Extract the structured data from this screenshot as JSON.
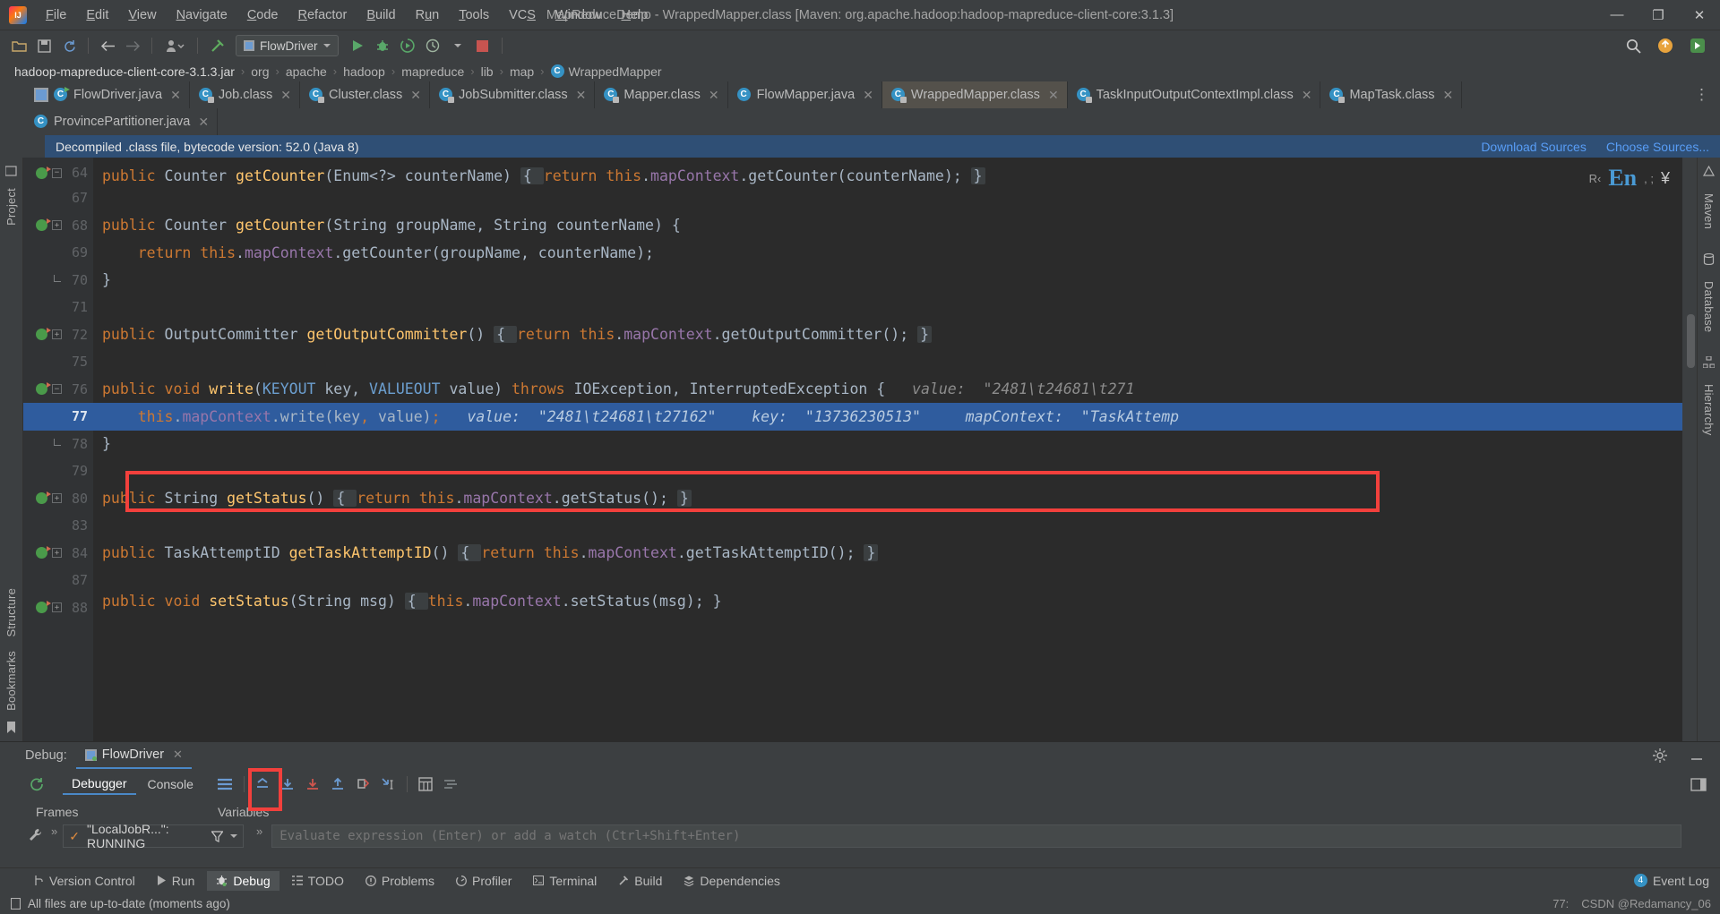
{
  "window": {
    "title": "MapReduceDemo - WrappedMapper.class [Maven: org.apache.hadoop:hadoop-mapreduce-client-core:3.1.3]",
    "minimize": "—",
    "maximize": "❐",
    "close": "✕"
  },
  "menu": [
    "File",
    "Edit",
    "View",
    "Navigate",
    "Code",
    "Refactor",
    "Build",
    "Run",
    "Tools",
    "VCS",
    "Window",
    "Help"
  ],
  "toolbar": {
    "run_config": "FlowDriver",
    "open_icon": "open-folder-icon",
    "save_icon": "save-icon",
    "sync_icon": "sync-icon",
    "back_icon": "back-arrow-icon",
    "forward_icon": "forward-arrow-icon",
    "profile_icon": "user-profile-icon",
    "build_icon": "hammer-icon",
    "run_icon": "run-icon",
    "debug_icon": "debug-icon",
    "coverage_icon": "run-with-coverage-icon",
    "profiler_icon": "profiler-icon",
    "stop_icon": "stop-icon",
    "search_icon": "search-icon",
    "update_icon": "update-badge-icon",
    "ide_icon": "ide-settings-icon"
  },
  "breadcrumb": {
    "root": "hadoop-mapreduce-client-core-3.1.3.jar",
    "path": [
      "org",
      "apache",
      "hadoop",
      "mapreduce",
      "lib",
      "map"
    ],
    "leaf": "WrappedMapper",
    "separator": "›"
  },
  "tabs_row1": [
    {
      "label": "FlowDriver.java",
      "icon": "java-class-runnable-icon",
      "active": false,
      "selected": false
    },
    {
      "label": "Job.class",
      "icon": "java-class-locked-icon",
      "active": false,
      "selected": false
    },
    {
      "label": "Cluster.class",
      "icon": "java-class-locked-icon",
      "active": false,
      "selected": false
    },
    {
      "label": "JobSubmitter.class",
      "icon": "java-class-locked-icon",
      "active": false,
      "selected": false
    },
    {
      "label": "Mapper.class",
      "icon": "java-class-locked-icon",
      "active": false,
      "selected": false
    },
    {
      "label": "FlowMapper.java",
      "icon": "java-class-icon",
      "active": false,
      "selected": false
    },
    {
      "label": "WrappedMapper.class",
      "icon": "java-class-locked-icon",
      "active": true,
      "selected": true
    },
    {
      "label": "TaskInputOutputContextImpl.class",
      "icon": "java-class-locked-icon",
      "active": false,
      "selected": false
    },
    {
      "label": "MapTask.class",
      "icon": "java-class-locked-icon",
      "active": false,
      "selected": false
    }
  ],
  "tabs_row2": [
    {
      "label": "ProvincePartitioner.java",
      "icon": "java-class-icon",
      "active": false,
      "selected": false
    }
  ],
  "notice": {
    "text": "Decompiled .class file, bytecode version: 52.0 (Java 8)",
    "download_sources": "Download Sources",
    "choose_sources": "Choose Sources..."
  },
  "editor_float": {
    "prefix": "R‹",
    "en": "En",
    "suffix": ", ;",
    "yen": "¥"
  },
  "left_toolbar": [
    "Project",
    "Structure",
    "Bookmarks"
  ],
  "right_toolbar": [
    "Maven",
    "Database",
    "Hierarchy"
  ],
  "code_lines": [
    {
      "num": "64",
      "marker": true,
      "fold": "minus",
      "text_parts": [
        {
          "t": "public ",
          "c": "kw"
        },
        {
          "t": "Counter ",
          "c": "typ"
        },
        {
          "t": "getCounter",
          "c": "meth"
        },
        {
          "t": "(Enum<?> counterName) ",
          "c": "typ"
        },
        {
          "t": "{ ",
          "c": "foldbox"
        },
        {
          "t": "return ",
          "c": "kw"
        },
        {
          "t": "this",
          "c": "kw"
        },
        {
          "t": ".",
          "c": "txt"
        },
        {
          "t": "mapContext",
          "c": "fld"
        },
        {
          "t": ".getCounter(counterName); }",
          "c": "txt"
        }
      ],
      "clipped": true
    },
    {
      "num": "67",
      "marker": false,
      "fold": "",
      "text_parts": []
    },
    {
      "num": "68",
      "marker": true,
      "fold": "minus",
      "text_parts": [
        {
          "t": "public ",
          "c": "kw"
        },
        {
          "t": "Counter ",
          "c": "typ"
        },
        {
          "t": "getCounter",
          "c": "meth"
        },
        {
          "t": "(",
          "c": "txt"
        },
        {
          "t": "String ",
          "c": "typ"
        },
        {
          "t": "groupName, ",
          "c": "txt"
        },
        {
          "t": "String ",
          "c": "typ"
        },
        {
          "t": "counterName",
          "c": "txt"
        },
        {
          "t": ") {",
          "c": "txt"
        }
      ]
    },
    {
      "num": "69",
      "marker": false,
      "fold": "",
      "text_parts": [
        {
          "t": "    ",
          "c": "txt"
        },
        {
          "t": "return ",
          "c": "kw"
        },
        {
          "t": "this",
          "c": "kw"
        },
        {
          "t": ".",
          "c": "txt"
        },
        {
          "t": "mapContext",
          "c": "fld"
        },
        {
          "t": ".getCounter(groupName, counterName);",
          "c": "txt"
        }
      ]
    },
    {
      "num": "70",
      "marker": false,
      "fold": "line",
      "text_parts": [
        {
          "t": "}",
          "c": "txt"
        }
      ]
    },
    {
      "num": "71",
      "marker": false,
      "fold": "",
      "text_parts": []
    },
    {
      "num": "72",
      "marker": true,
      "fold": "plus",
      "text_parts": [
        {
          "t": "public ",
          "c": "kw"
        },
        {
          "t": "OutputCommitter ",
          "c": "typ"
        },
        {
          "t": "getOutputCommitter",
          "c": "meth"
        },
        {
          "t": "() ",
          "c": "txt"
        },
        {
          "t": "{ ",
          "c": "foldbox"
        },
        {
          "t": "return ",
          "c": "kw"
        },
        {
          "t": "this",
          "c": "kw"
        },
        {
          "t": ".",
          "c": "txt"
        },
        {
          "t": "mapContext",
          "c": "fld"
        },
        {
          "t": ".getOutputCommitter(); ",
          "c": "txt"
        },
        {
          "t": "}",
          "c": "foldbox"
        }
      ]
    },
    {
      "num": "75",
      "marker": false,
      "fold": "",
      "text_parts": []
    },
    {
      "num": "76",
      "marker": true,
      "fold": "minus",
      "text_parts": [
        {
          "t": "public void ",
          "c": "kw"
        },
        {
          "t": "write",
          "c": "meth"
        },
        {
          "t": "(",
          "c": "txt"
        },
        {
          "t": "KEYOUT ",
          "c": "cls2"
        },
        {
          "t": "key, ",
          "c": "txt"
        },
        {
          "t": "VALUEOUT ",
          "c": "cls2"
        },
        {
          "t": "value) ",
          "c": "txt"
        },
        {
          "t": "throws ",
          "c": "kw"
        },
        {
          "t": "IOException, InterruptedException {",
          "c": "txt"
        },
        {
          "t": "   value:  \"2481\\t24681\\t271",
          "c": "hint"
        }
      ],
      "clipped": true
    },
    {
      "num": "77",
      "marker": false,
      "fold": "",
      "highlight": true,
      "text_parts": [
        {
          "t": "    ",
          "c": "txt"
        },
        {
          "t": "this",
          "c": "kw"
        },
        {
          "t": ".",
          "c": "txt"
        },
        {
          "t": "mapContext",
          "c": "fld"
        },
        {
          "t": ".write(key",
          "c": "txt"
        },
        {
          "t": ",",
          "c": "kw"
        },
        {
          "t": " value)",
          "c": "txt"
        },
        {
          "t": ";",
          "c": "kw"
        },
        {
          "t": "   value: ",
          "c": "hint-hl"
        },
        {
          "t": " \"2481\\t24681\\t27162\"",
          "c": "hint-hl"
        },
        {
          "t": "    key: ",
          "c": "hint-hl"
        },
        {
          "t": " \"13736230513\"",
          "c": "hint-hl"
        },
        {
          "t": "     mapContext: ",
          "c": "hint-hl"
        },
        {
          "t": " \"TaskAttemp",
          "c": "hint-hl"
        }
      ]
    },
    {
      "num": "78",
      "marker": false,
      "fold": "line",
      "text_parts": [
        {
          "t": "}",
          "c": "txt"
        }
      ]
    },
    {
      "num": "79",
      "marker": false,
      "fold": "",
      "text_parts": []
    },
    {
      "num": "80",
      "marker": true,
      "fold": "plus",
      "text_parts": [
        {
          "t": "public ",
          "c": "kw"
        },
        {
          "t": "String ",
          "c": "typ"
        },
        {
          "t": "getStatus",
          "c": "meth"
        },
        {
          "t": "() ",
          "c": "txt"
        },
        {
          "t": "{ ",
          "c": "foldbox"
        },
        {
          "t": "return ",
          "c": "kw"
        },
        {
          "t": "this",
          "c": "kw"
        },
        {
          "t": ".",
          "c": "txt"
        },
        {
          "t": "mapContext",
          "c": "fld"
        },
        {
          "t": ".getStatus(); ",
          "c": "txt"
        },
        {
          "t": "}",
          "c": "foldbox"
        }
      ]
    },
    {
      "num": "83",
      "marker": false,
      "fold": "",
      "text_parts": []
    },
    {
      "num": "84",
      "marker": true,
      "fold": "plus",
      "text_parts": [
        {
          "t": "public ",
          "c": "kw"
        },
        {
          "t": "TaskAttemptID ",
          "c": "typ"
        },
        {
          "t": "getTaskAttemptID",
          "c": "meth"
        },
        {
          "t": "() ",
          "c": "txt"
        },
        {
          "t": "{ ",
          "c": "foldbox"
        },
        {
          "t": "return ",
          "c": "kw"
        },
        {
          "t": "this",
          "c": "kw"
        },
        {
          "t": ".",
          "c": "txt"
        },
        {
          "t": "mapContext",
          "c": "fld"
        },
        {
          "t": ".getTaskAttemptID(); ",
          "c": "txt"
        },
        {
          "t": "}",
          "c": "foldbox"
        }
      ]
    },
    {
      "num": "87",
      "marker": false,
      "fold": "",
      "text_parts": []
    },
    {
      "num": "88",
      "marker": true,
      "fold": "plus",
      "text_parts": [
        {
          "t": "public void ",
          "c": "kw"
        },
        {
          "t": "setStatus",
          "c": "meth"
        },
        {
          "t": "(",
          "c": "txt"
        },
        {
          "t": "String ",
          "c": "typ"
        },
        {
          "t": "msg) ",
          "c": "txt"
        },
        {
          "t": "{ ",
          "c": "foldbox"
        },
        {
          "t": "this",
          "c": "kw"
        },
        {
          "t": ".",
          "c": "txt"
        },
        {
          "t": "mapContext",
          "c": "fld"
        },
        {
          "t": ".setStatus(msg); }",
          "c": "txt"
        }
      ],
      "clipped": true
    }
  ],
  "debug": {
    "panel_label": "Debug:",
    "session_tab": "FlowDriver",
    "subtabs": [
      {
        "label": "Debugger",
        "active": true
      },
      {
        "label": "Console",
        "active": false
      }
    ],
    "frames_header": "Frames",
    "variables_header": "Variables",
    "thread": "\"LocalJobR...\": RUNNING",
    "watch_placeholder": "Evaluate expression (Enter) or add a watch (Ctrl+Shift+Enter)",
    "buttons": {
      "rerun": "rerun-icon",
      "show_execution_point": "show-execution-point-icon",
      "step_over": "step-over-icon",
      "step_into": "step-into-icon",
      "force_step_into": "force-step-into-icon",
      "step_out": "step-out-icon",
      "drop_frame": "drop-frame-icon",
      "run_to_cursor": "run-to-cursor-icon",
      "evaluate": "evaluate-expression-icon",
      "mute_breakpoints": "mute-breakpoints-icon",
      "settings": "settings-gear-icon",
      "hide": "hide-panel-icon",
      "layout": "layout-icon",
      "wrench": "wrench-icon"
    }
  },
  "bottom_bar": [
    {
      "label": "Version Control",
      "icon": "branch-icon",
      "active": false
    },
    {
      "label": "Run",
      "icon": "run-icon",
      "active": false
    },
    {
      "label": "Debug",
      "icon": "debug-icon",
      "active": true
    },
    {
      "label": "TODO",
      "icon": "todo-list-icon",
      "active": false
    },
    {
      "label": "Problems",
      "icon": "problems-icon",
      "active": false
    },
    {
      "label": "Profiler",
      "icon": "profiler-icon",
      "active": false
    },
    {
      "label": "Terminal",
      "icon": "terminal-icon",
      "active": false
    },
    {
      "label": "Build",
      "icon": "build-hammer-icon",
      "active": false
    },
    {
      "label": "Dependencies",
      "icon": "dependencies-icon",
      "active": false
    }
  ],
  "event_log": {
    "label": "Event Log",
    "badge": "4"
  },
  "status": {
    "message": "All files are up-to-date (moments ago)",
    "right_info": "77:",
    "watermark": "CSDN @Redamancy_06"
  }
}
